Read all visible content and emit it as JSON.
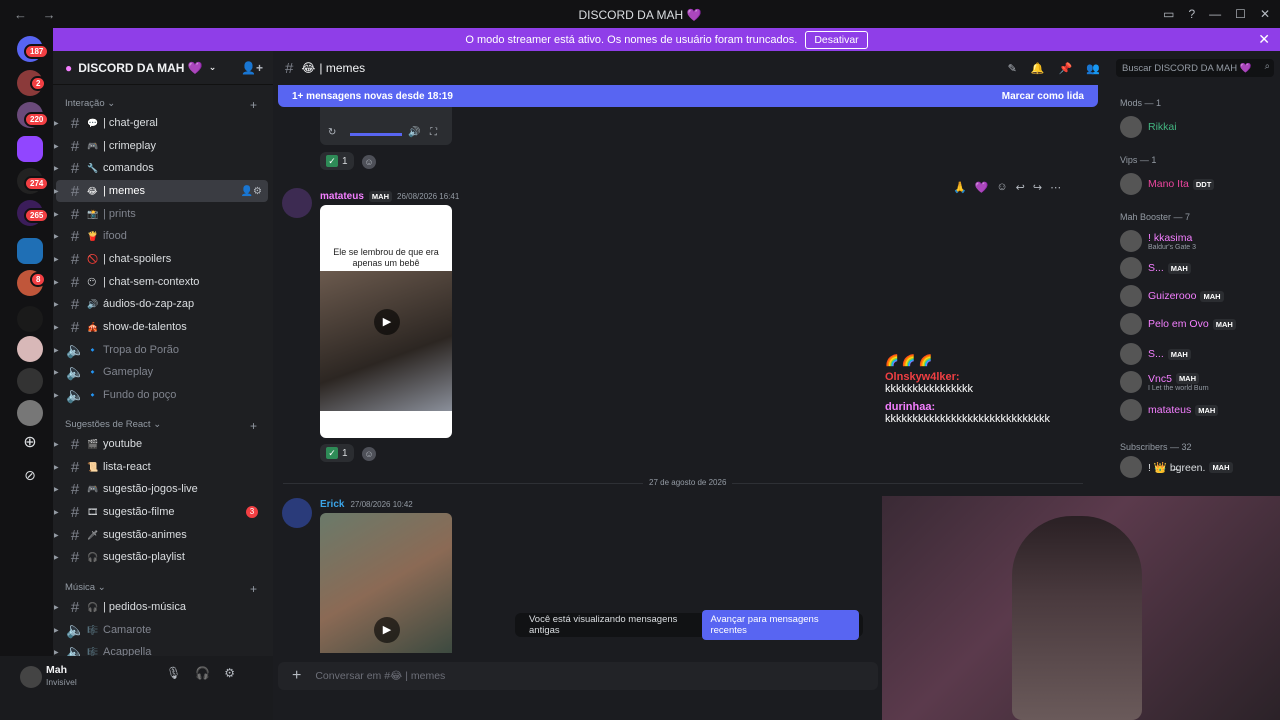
{
  "window": {
    "title": "DISCORD DA MAH 💜"
  },
  "streamer_bar": {
    "text": "O modo streamer está ativo. Os nomes de usuário foram truncados.",
    "button": "Desativar"
  },
  "server_badges": [
    "187",
    "2",
    "220",
    "274",
    "265",
    "8"
  ],
  "guild": {
    "name": "DISCORD DA MAH 💜"
  },
  "categories": [
    {
      "label": "Interação"
    },
    {
      "label": "Sugestões de React"
    },
    {
      "label": "Música"
    }
  ],
  "channels": [
    {
      "name": "| chat-geral",
      "emoji": "💬"
    },
    {
      "name": "| crimeplay",
      "emoji": "🎮"
    },
    {
      "name": "comandos",
      "emoji": "🔧"
    },
    {
      "name": "| memes",
      "emoji": "😂"
    },
    {
      "name": "| prints",
      "emoji": "📸"
    },
    {
      "name": "ifood",
      "emoji": "🍟"
    },
    {
      "name": "| chat-spoilers",
      "emoji": "🚫"
    },
    {
      "name": "| chat-sem-contexto",
      "emoji": "😶"
    },
    {
      "name": "áudios-do-zap-zap",
      "emoji": "🔊"
    },
    {
      "name": "show-de-talentos",
      "emoji": "🎪"
    },
    {
      "name": "Tropa do Porão",
      "emoji": "🔹"
    },
    {
      "name": "Gameplay",
      "emoji": "🔹"
    },
    {
      "name": "Fundo do poço",
      "emoji": "🔹"
    },
    {
      "name": "youtube",
      "emoji": "🎬"
    },
    {
      "name": "lista-react",
      "emoji": "📜"
    },
    {
      "name": "sugestão-jogos-live",
      "emoji": "🎮"
    },
    {
      "name": "sugestão-filme",
      "emoji": "🎞"
    },
    {
      "name": "sugestão-animes",
      "emoji": "🗡"
    },
    {
      "name": "sugestão-playlist",
      "emoji": "🎧"
    },
    {
      "name": "| pedidos-música",
      "emoji": "🎧"
    },
    {
      "name": "Camarote",
      "emoji": "🎼"
    },
    {
      "name": "Acappella",
      "emoji": "🎼"
    }
  ],
  "channel_badge": "3",
  "user": {
    "name": "Mah",
    "status": "Invisível"
  },
  "chat": {
    "channel": "| memes",
    "new_messages": "1+ mensagens novas desde 18:19",
    "mark_read": "Marcar como lida",
    "msg1": {
      "author": "matateus",
      "tag": "MAH",
      "time": "26/08/2026 16:41",
      "caption": "Ele se lembrou de que era apenas um bebê"
    },
    "reaction_count": "1",
    "date_divider": "27 de agosto de 2026",
    "msg2": {
      "author": "Erick",
      "time": "27/08/2026 10:42"
    },
    "old_messages": "Você está visualizando mensagens antigas",
    "jump": "Avançar para mensagens recentes",
    "composer_placeholder": "Conversar em #😂 | memes"
  },
  "overlay_chat": [
    {
      "user": "Olnskyw4lker:",
      "text": "kkkkkkkkkkkkkkkk"
    },
    {
      "user": "durinhaa:",
      "text": "kkkkkkkkkkkkkkkkkkkkkkkkkkkkkk"
    }
  ],
  "members": {
    "search": "Buscar DISCORD DA MAH 💜",
    "groups": [
      {
        "label": "Mods — 1"
      },
      {
        "label": "Vips — 1"
      },
      {
        "label": "Mah Booster — 7"
      },
      {
        "label": "Subscribers — 32"
      }
    ],
    "list": [
      {
        "name": "Rikkai",
        "color": "#43b581",
        "tag": ""
      },
      {
        "name": "Mano Ita",
        "color": "#eb459e",
        "tag": "DDT"
      },
      {
        "name": "! kkasima",
        "color": "#f47fff",
        "tag": "",
        "sub": "Baldur's Gate 3"
      },
      {
        "name": "S...",
        "color": "#f47fff",
        "tag": "MAH"
      },
      {
        "name": "Guizerooo",
        "color": "#f47fff",
        "tag": "MAH"
      },
      {
        "name": "Pelo em Ovo",
        "color": "#f47fff",
        "tag": "MAH"
      },
      {
        "name": "S...",
        "color": "#f47fff",
        "tag": "MAH"
      },
      {
        "name": "Vnc5",
        "color": "#f47fff",
        "tag": "MAH",
        "sub": "I Let the world Burn"
      },
      {
        "name": "matateus",
        "color": "#f47fff",
        "tag": "MAH"
      },
      {
        "name": "! 👑 b̶green.",
        "color": "#dbdee1",
        "tag": "MAH"
      }
    ]
  }
}
